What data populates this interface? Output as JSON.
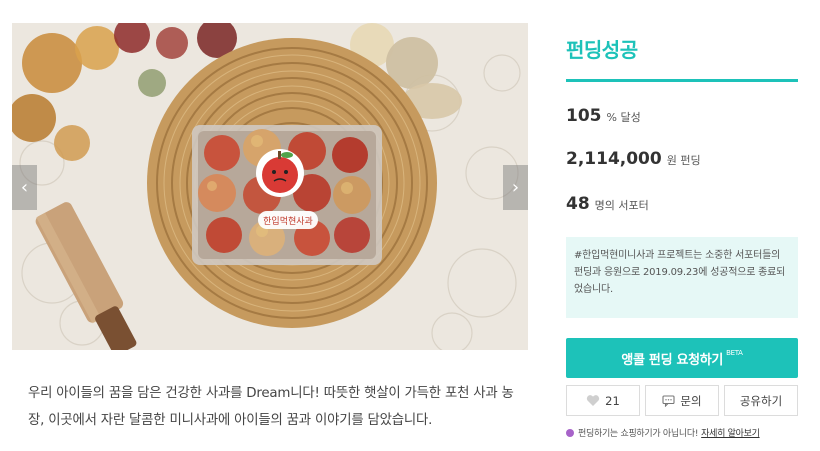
{
  "campaign": {
    "description": "우리 아이들의 꿈을 담은 건강한 사과를 Dream니다! 따뜻한 햇살이 가득한 포천 사과 농장, 이곳에서 자란 달콤한 미니사과에 아이들의 꿈과 이야기를 담았습니다.",
    "sticker_text": "한입먹현사과"
  },
  "gallery": {
    "prev_icon": "‹",
    "next_icon": "›"
  },
  "status": {
    "title": "펀딩성공",
    "rate_value": "105",
    "rate_unit": "% 달성",
    "amount_value": "2,114,000",
    "amount_unit": "원 펀딩",
    "supporters_value": "48",
    "supporters_unit": "명의 서포터",
    "notice": "#한입먹현미니사과 프로젝트는 소중한 서포터들의 펀딩과 응원으로 2019.09.23에 성공적으로 종료되었습니다."
  },
  "actions": {
    "encore_label": "앵콜 펀딩 요청하기",
    "encore_badge": "BETA",
    "like_count": "21",
    "inquiry_label": "문의",
    "share_label": "공유하기"
  },
  "footnote": {
    "text": "펀딩하기는 쇼핑하기가 아닙니다!",
    "link": "자세히 알아보기"
  },
  "colors": {
    "accent": "#1dc2b9",
    "notice_bg": "#e6f8f6",
    "dot": "#a763c9"
  }
}
